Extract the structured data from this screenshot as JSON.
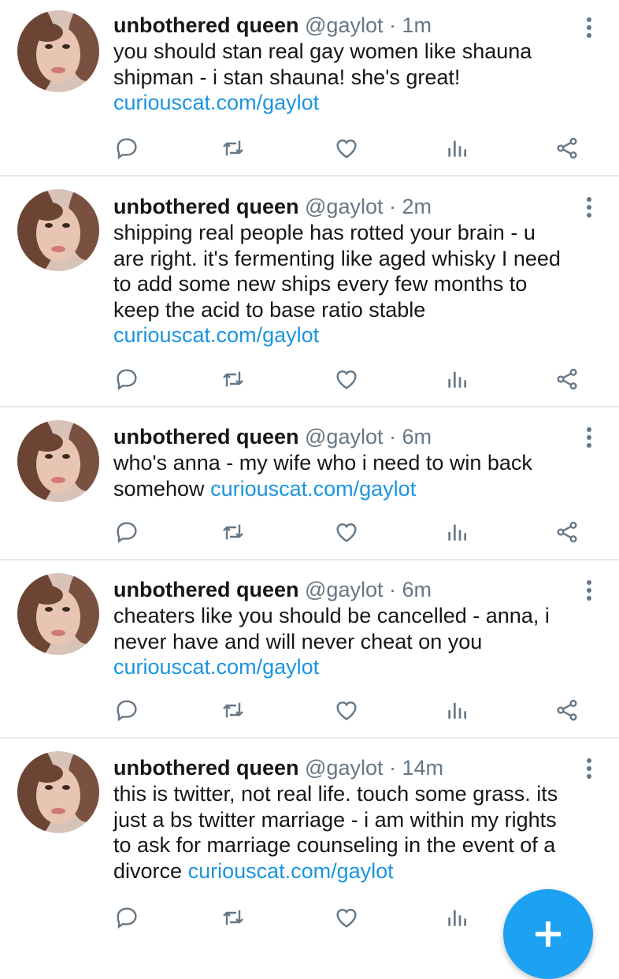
{
  "tweets": [
    {
      "name": "unbothered queen",
      "handle": "@gaylot",
      "sep": "·",
      "time": "1m",
      "text": "you should stan real gay women like shauna shipman - i stan shauna! she's great!",
      "link": "curiouscat.com/gaylot"
    },
    {
      "name": "unbothered queen",
      "handle": "@gaylot",
      "sep": "·",
      "time": "2m",
      "text": "shipping real people has rotted your brain - u are right. it's fermenting like aged whisky I need to add some new ships every few months to keep the acid to base ratio stable",
      "link": "curiouscat.com/gaylot"
    },
    {
      "name": "unbothered queen",
      "handle": "@gaylot",
      "sep": "·",
      "time": "6m",
      "text": "who's anna - my wife who i need to win back somehow",
      "link": "curiouscat.com/gaylot"
    },
    {
      "name": "unbothered queen",
      "handle": "@gaylot",
      "sep": "·",
      "time": "6m",
      "text": "cheaters like you should be cancelled - anna, i never have and will never cheat on you",
      "link": "curiouscat.com/gaylot"
    },
    {
      "name": "unbothered queen",
      "handle": "@gaylot",
      "sep": "·",
      "time": "14m",
      "text": "this is twitter, not real life. touch some grass. its just a bs twitter marriage - i am within my rights to ask for marriage counseling in the event of a divorce",
      "link": "curiouscat.com/gaylot"
    }
  ],
  "icons": {
    "reply": "reply-icon",
    "retweet": "retweet-icon",
    "like": "heart-icon",
    "analytics": "analytics-icon",
    "share": "share-icon",
    "more": "more-vertical-icon",
    "compose": "plus-icon"
  },
  "colors": {
    "link": "#1b95e0",
    "meta": "#657786",
    "accent": "#1da1f2"
  }
}
